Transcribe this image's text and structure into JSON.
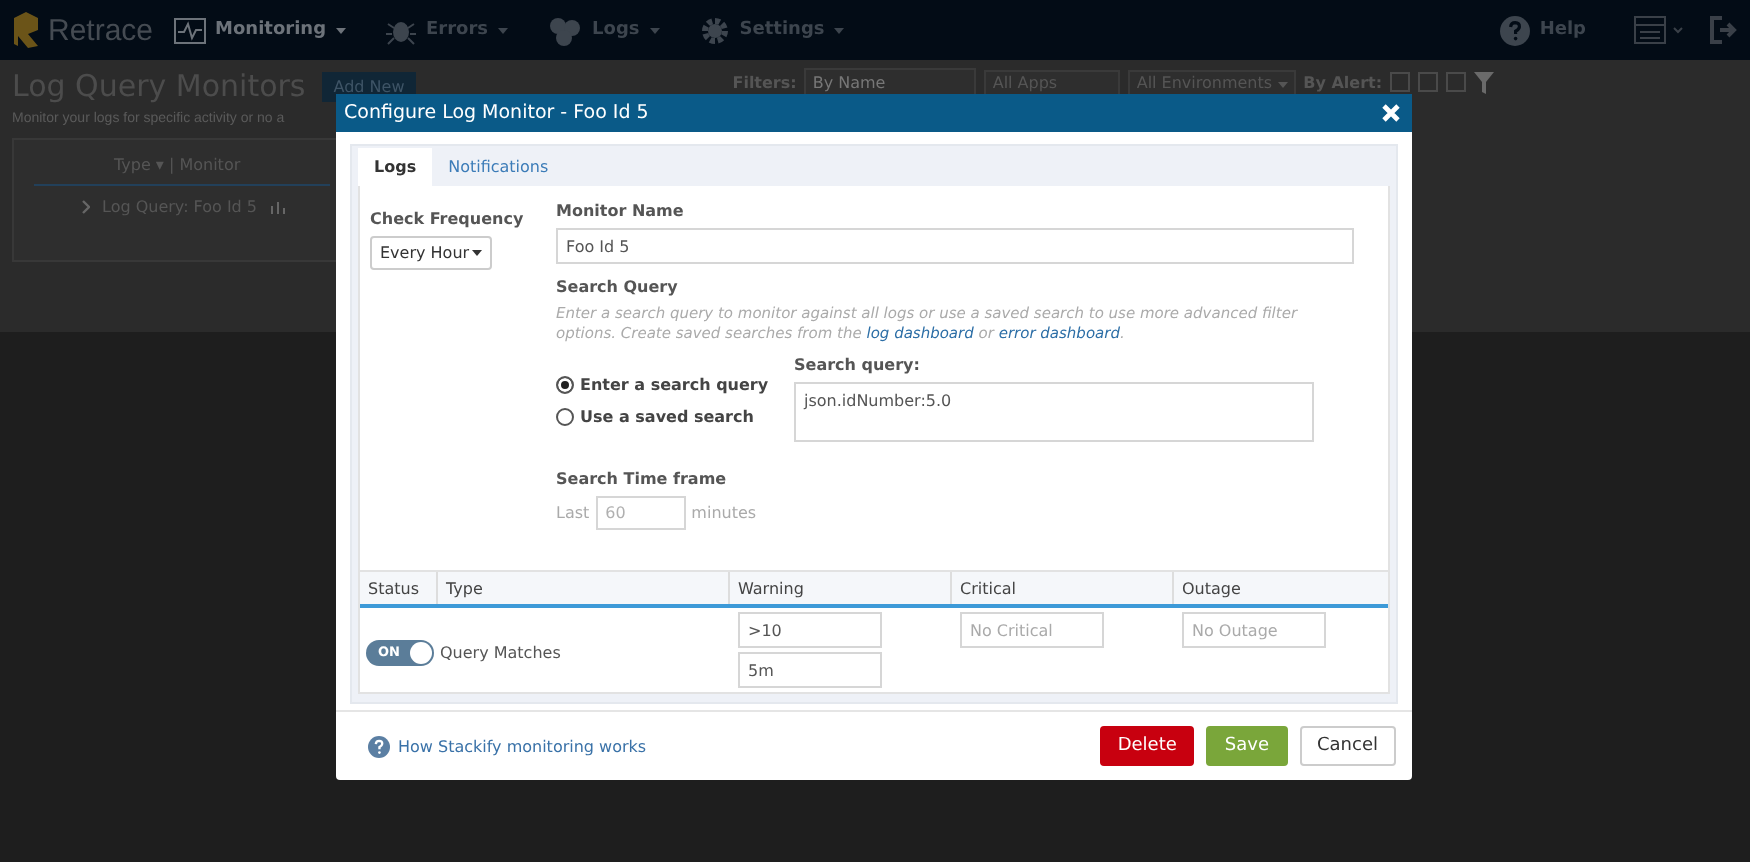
{
  "navbar": {
    "brand": "Retrace",
    "items": [
      {
        "label": "Monitoring",
        "selected": true
      },
      {
        "label": "Errors",
        "selected": false
      },
      {
        "label": "Logs",
        "selected": false
      },
      {
        "label": "Settings",
        "selected": false
      }
    ],
    "help": "Help"
  },
  "page": {
    "title": "Log Query Monitors",
    "add_button": "Add New",
    "description": "Monitor your logs for specific activity or no a",
    "filters": {
      "label": "Filters:",
      "search_placeholder": "By Name",
      "apps": "All Apps",
      "environments": "All Environments",
      "alert_label": "By Alert:",
      "alert_checkboxes": [
        {
          "checked": false
        },
        {
          "checked": false
        },
        {
          "checked": false
        }
      ]
    },
    "table": {
      "header": "Type ▾ | Monitor",
      "rows": [
        {
          "label": "Log Query: Foo Id 5"
        }
      ]
    }
  },
  "dialog": {
    "title": "Configure Log Monitor - Foo Id 5",
    "tabs": [
      {
        "label": "Logs",
        "selected": true
      },
      {
        "label": "Notifications",
        "selected": false
      }
    ],
    "check_frequency": {
      "label": "Check Frequency",
      "value": "Every Hour"
    },
    "monitor_name": {
      "label": "Monitor Name",
      "value": "Foo Id 5"
    },
    "search_query": {
      "label": "Search Query",
      "help": [
        {
          "kind": "text",
          "text": "Enter a search query to monitor against all logs or use a saved search to use more advanced filter options. Create saved searches from the "
        },
        {
          "kind": "link",
          "text": "log dashboard"
        },
        {
          "kind": "text",
          "text": " or "
        },
        {
          "kind": "link",
          "text": "error dashboard"
        },
        {
          "kind": "text",
          "text": "."
        }
      ],
      "options": [
        {
          "label": "Enter a search query",
          "selected": true
        },
        {
          "label": "Use a saved search",
          "selected": false
        }
      ],
      "query_label": "Search query:",
      "query": "json.idNumber:5.0"
    },
    "timeframe": {
      "label": "Search Time frame",
      "prefix": "Last",
      "placeholder": "60",
      "suffix": "minutes"
    },
    "thresholds": {
      "columns": [
        "Status",
        "Type",
        "Warning",
        "Critical",
        "Outage"
      ],
      "rows": [
        {
          "on": true,
          "toggle_label": "ON",
          "type": "Query Matches",
          "warning": [
            ">10",
            "5m"
          ],
          "critical_placeholder": "No Critical",
          "outage_placeholder": "No Outage"
        }
      ]
    },
    "help_link": "How Stackify monitoring works",
    "buttons": [
      {
        "label": "Delete",
        "kind": "danger"
      },
      {
        "label": "Save",
        "kind": "primary"
      },
      {
        "label": "Cancel",
        "kind": "default"
      }
    ]
  }
}
